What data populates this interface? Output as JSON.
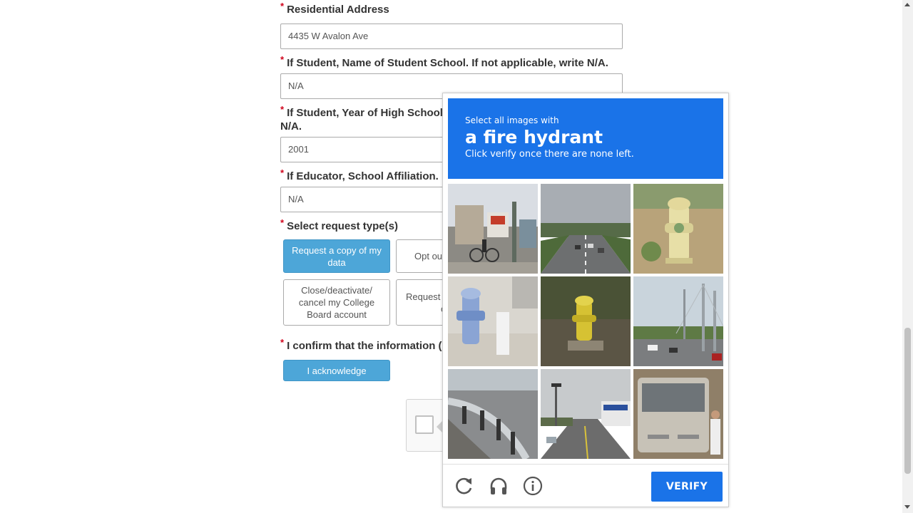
{
  "form": {
    "required_mark": "*",
    "residential_address": {
      "label": "Residential Address",
      "value": "4435 W Avalon Ave"
    },
    "student_school": {
      "label": "If Student, Name of Student School. If not applicable, write N/A.",
      "value": "N/A"
    },
    "student_year": {
      "label_line1": "If Student, Year of High School (",
      "label_line2": "N/A.",
      "value": "2001"
    },
    "educator_affiliation": {
      "label": "If Educator, School Affiliation. If",
      "value": "N/A"
    },
    "request_types": {
      "label": "Select request type(s)",
      "options": [
        {
          "label": "Request a copy of my data",
          "selected": true
        },
        {
          "label": "Opt out",
          "selected": false
        },
        {
          "label": "Close/deactivate/ cancel my College Board account",
          "selected": false
        },
        {
          "label": "Request t",
          "label_line2": "c",
          "selected": false
        }
      ]
    },
    "confirm": {
      "label": "I confirm that the information (",
      "button": "I acknowledge"
    }
  },
  "recaptcha_challenge": {
    "header_small": "Select all images with",
    "header_big": "a fire hydrant",
    "header_sub": "Click verify once there are none left.",
    "tiles": [
      "street-scene-with-bicycle",
      "highway-road",
      "yellow-fire-hydrant",
      "blue-fire-hydrant",
      "yellow-fire-hydrant-grass",
      "bridge-highway",
      "guardrail-curve",
      "city-street",
      "bus"
    ],
    "icons": [
      "reload-icon",
      "audio-headphones-icon",
      "info-icon"
    ],
    "verify_label": "VERIFY",
    "accent_color": "#1a73e8"
  }
}
